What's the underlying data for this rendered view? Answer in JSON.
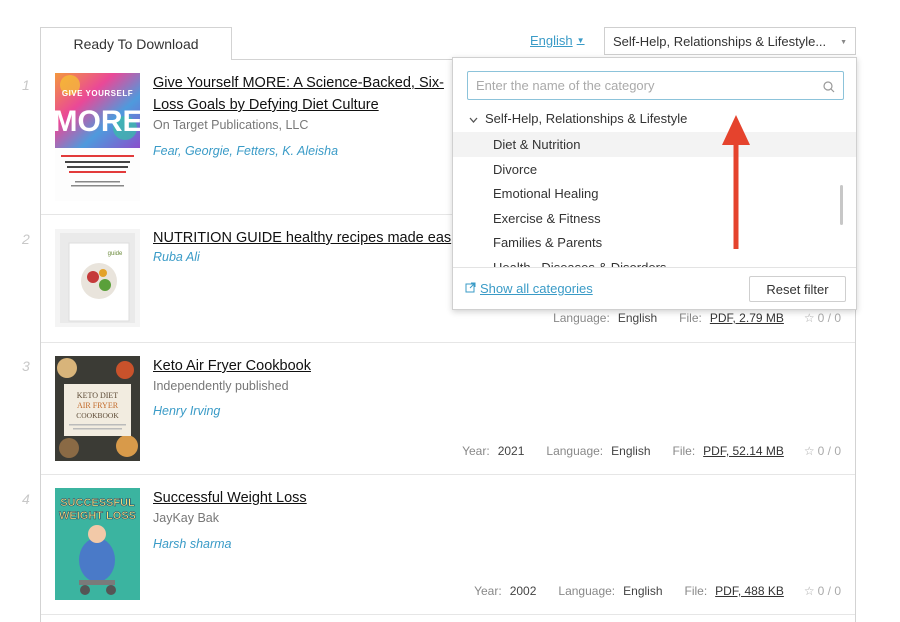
{
  "tab": {
    "label": "Ready To Download"
  },
  "filters": {
    "language": "English",
    "category": "Self-Help, Relationships & Lifestyle..."
  },
  "dropdown": {
    "search_placeholder": "Enter the name of the category",
    "parent": "Self-Help, Relationships & Lifestyle",
    "items": [
      "Diet & Nutrition",
      "Divorce",
      "Emotional Healing",
      "Exercise & Fitness",
      "Families & Parents",
      "Health , Diseases & Disorders"
    ],
    "show_all": "Show all categories",
    "reset": "Reset filter"
  },
  "labels": {
    "year": "Year:",
    "language": "Language:",
    "file": "File:"
  },
  "books": [
    {
      "num": "1",
      "title_line1": "Give Yourself MORE: A Science-Backed, Six-",
      "title_line2": "Loss Goals by Defying Diet Culture",
      "publisher": "On Target Publications, LLC",
      "authors": "Fear, Georgie, Fetters, K. Aleisha",
      "cover": {
        "top": "GIVE YOURSELF",
        "big": "MORE",
        "sub": "A SCIENCE-BACKED, SIX-PART PLAN FOR WOMEN TO HIT THEIR WEIGHT-LOSS GOALS BY DEFYING DIET CULTURE"
      }
    },
    {
      "num": "2",
      "title": "NUTRITION GUIDE healthy recipes made eas",
      "authors": "Ruba Ali",
      "language": "English",
      "file": "PDF, 2.79 MB",
      "rating": "0 / 0",
      "cover": {
        "label": "guide"
      }
    },
    {
      "num": "3",
      "title": "Keto Air Fryer Cookbook",
      "publisher": "Independently published",
      "authors": "Henry Irving",
      "year": "2021",
      "language": "English",
      "file": "PDF, 52.14 MB",
      "rating": "0 / 0",
      "cover": {
        "line1": "KETO DIET",
        "line2": "AIR FRYER",
        "line3": "COOKBOOK"
      }
    },
    {
      "num": "4",
      "title": "Successful Weight Loss",
      "publisher": "JayKay Bak",
      "authors": "Harsh sharma",
      "year": "2002",
      "language": "English",
      "file": "PDF, 488 KB",
      "rating": "0 / 0",
      "cover": {
        "line1": "SUCCESSFUL",
        "line2": "WEIGHT LOSS"
      }
    }
  ],
  "colors": {
    "accent": "#3a9bc7",
    "arrow": "#e5432d"
  },
  "icons": {
    "search": "search-icon",
    "external": "external-link-icon",
    "star": "star-icon",
    "chevron": "chevron-down-icon"
  }
}
